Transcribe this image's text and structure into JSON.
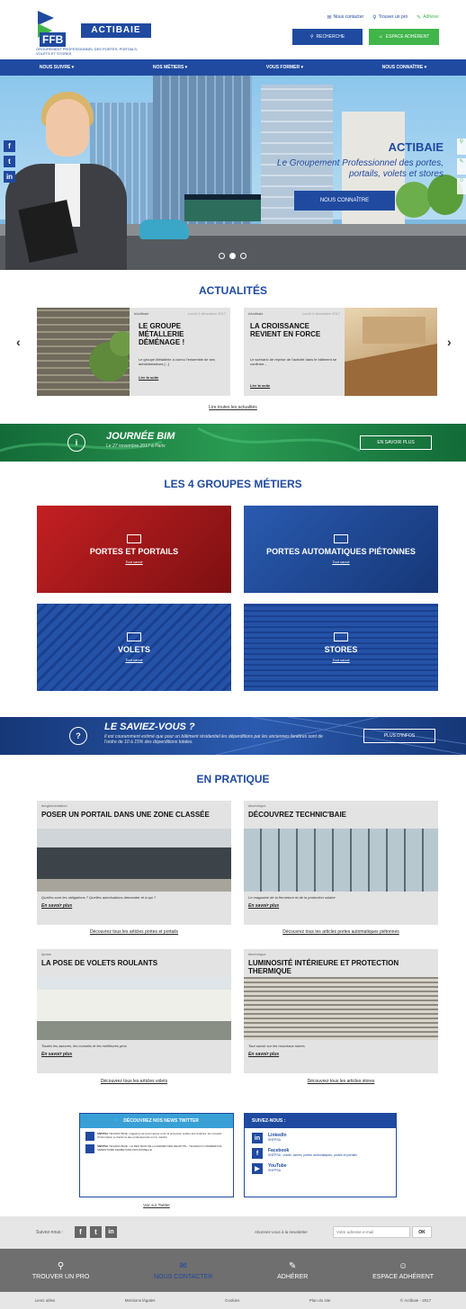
{
  "header": {
    "logo_ffb": "FFB",
    "logo_brand": "ACTIBAIE",
    "logo_tagline": "GROUPEMENT PROFESSIONNEL DES PORTES, PORTAILS, VOLETS ET STORES",
    "top_links": [
      "Nous contacter",
      "Trouver un pro",
      "Adhérer"
    ],
    "search_label": "RECHERCHE",
    "member_label": "ESPACE ADHÉRENT"
  },
  "nav": [
    "NOUS SUIVRE",
    "NOS MÉTIERS",
    "VOUS FORMER",
    "NOUS CONNAÎTRE"
  ],
  "hero": {
    "title": "ACTIBAIE",
    "subtitle": "Le Groupement Professionnel des portes, portails, volets et stores",
    "cta": "NOUS CONNAÎTRE",
    "social": [
      "f",
      "t",
      "in"
    ]
  },
  "news": {
    "heading": "ACTUALITÉS",
    "items": [
      {
        "tag": "#Actibaie",
        "date": "Lundi 4 décembre 2017",
        "title": "LE GROUPE MÉTALLERIE DÉMÉNAGE !",
        "desc": "Le groupe Métallerie a connu l'ensemble de ses administrateurs [...]",
        "more": "Lire la suite"
      },
      {
        "tag": "#Actibaie",
        "date": "Lundi 4 décembre 2017",
        "title": "LA CROISSANCE REVIENT EN FORCE",
        "desc": "Le scénario de reprise de l'activité dans le bâtiment se confirme...",
        "more": "Lire la suite"
      }
    ],
    "all_link": "Lire toutes les actualités"
  },
  "bim": {
    "title": "JOURNÉE BIM",
    "sub": "Le 27 novembre 2017 à Paris",
    "button": "EN SAVOIR PLUS"
  },
  "groups": {
    "heading": "LES 4 GROUPES MÉTIERS",
    "items": [
      {
        "title": "PORTES ET PORTAILS",
        "link": "Tout savoir",
        "color": "#b0191c"
      },
      {
        "title": "PORTES AUTOMATIQUES PIÉTONNES",
        "link": "Tout savoir",
        "color": "#1f4aa0"
      },
      {
        "title": "VOLETS",
        "link": "Tout savoir",
        "color": "#1f4aa0"
      },
      {
        "title": "STORES",
        "link": "Tout savoir",
        "color": "#1f4aa0"
      }
    ]
  },
  "savez": {
    "title": "LE SAVIEZ-VOUS ?",
    "text": "Il est couramment estimé que pour un bâtiment résidentiel les déperditions par les anciennes fenêtres sont de l'ordre de 10 à 15% des déperditions totales.",
    "button": "PLUS D'INFOS"
  },
  "pratique": {
    "heading": "EN PRATIQUE",
    "items": [
      {
        "tag": "#reglementation",
        "date": "Lundi 4 décembre 2017",
        "title": "POSER UN PORTAIL DANS UNE ZONE CLASSÉE",
        "desc": "Quelles sont les obligations ? Quelles autorisations demander et à qui ?",
        "more": "En savoir plus",
        "link": "Découvrez tous les articles portes et portails"
      },
      {
        "tag": "#technique",
        "date": "Lundi 4 décembre 2017",
        "title": "DÉCOUVREZ TECHNIC'BAIE",
        "desc": "Le magazine de la fermeture et de la protection solaire",
        "more": "En savoir plus",
        "link": "Découvrez tous les articles portes automatiques piétonnes"
      },
      {
        "tag": "#pose",
        "date": "Lundi 4 décembre 2017",
        "title": "LA POSE DE VOLETS ROULANTS",
        "desc": "Toutes les astuces, les conseils et les meilleures pros",
        "more": "En savoir plus",
        "link": "Découvrez tous les articles volets"
      },
      {
        "tag": "#technique",
        "date": "Lundi 4 décembre 2017",
        "title": "LUMINOSITÉ INTÉRIEURE ET PROTECTION THERMIQUE",
        "desc": "Tout savoir sur les nouveaux stores",
        "more": "En savoir plus",
        "link": "Découvrez tous les articles stores"
      }
    ]
  },
  "twitter": {
    "heading": "DÉCOUVREZ NOS NEWS TWITTER",
    "tweets": [
      {
        "author": "SNFPSA",
        "text": "TECHNIC'BAIE, magazine de la fermeture et de la protection solaire des fenêtres, les conseils d'information et d'actions des professionnels sur le marché"
      },
      {
        "author": "SNFPSA",
        "text": "TECHNIC'BAIE - LE RECTEUR DE LA FERMETURE RECRUTE : TECHNICO-COMMERCIAL SÉDENTAIRE FERMETURE INDUSTRIELLE"
      }
    ],
    "link": "Voir sur Twitter"
  },
  "follow": {
    "heading": "SUIVEZ-NOUS :",
    "items": [
      {
        "icon": "in",
        "name": "LinkedIn",
        "desc": "SNFPSA"
      },
      {
        "icon": "f",
        "name": "Facebook",
        "desc": "SNFPSA : volets, stores, portes automatiques, portes et portails"
      },
      {
        "icon": "▶",
        "name": "YouTube",
        "desc": "SNFPSA"
      }
    ]
  },
  "footer": {
    "follow_label": "Suivez-nous :",
    "newsletter_label": "Abonnez-vous à la newsletter",
    "newsletter_placeholder": "Votre adresse e-mail",
    "ok": "OK",
    "buttons": [
      "TROUVER UN PRO",
      "NOUS CONTACTER",
      "ADHÉRER",
      "ESPACE ADHÉRENT"
    ],
    "links": [
      "Liens utiles",
      "Mentions légales",
      "Cookies",
      "Plan du site",
      "© Actibaie - 2017"
    ]
  }
}
